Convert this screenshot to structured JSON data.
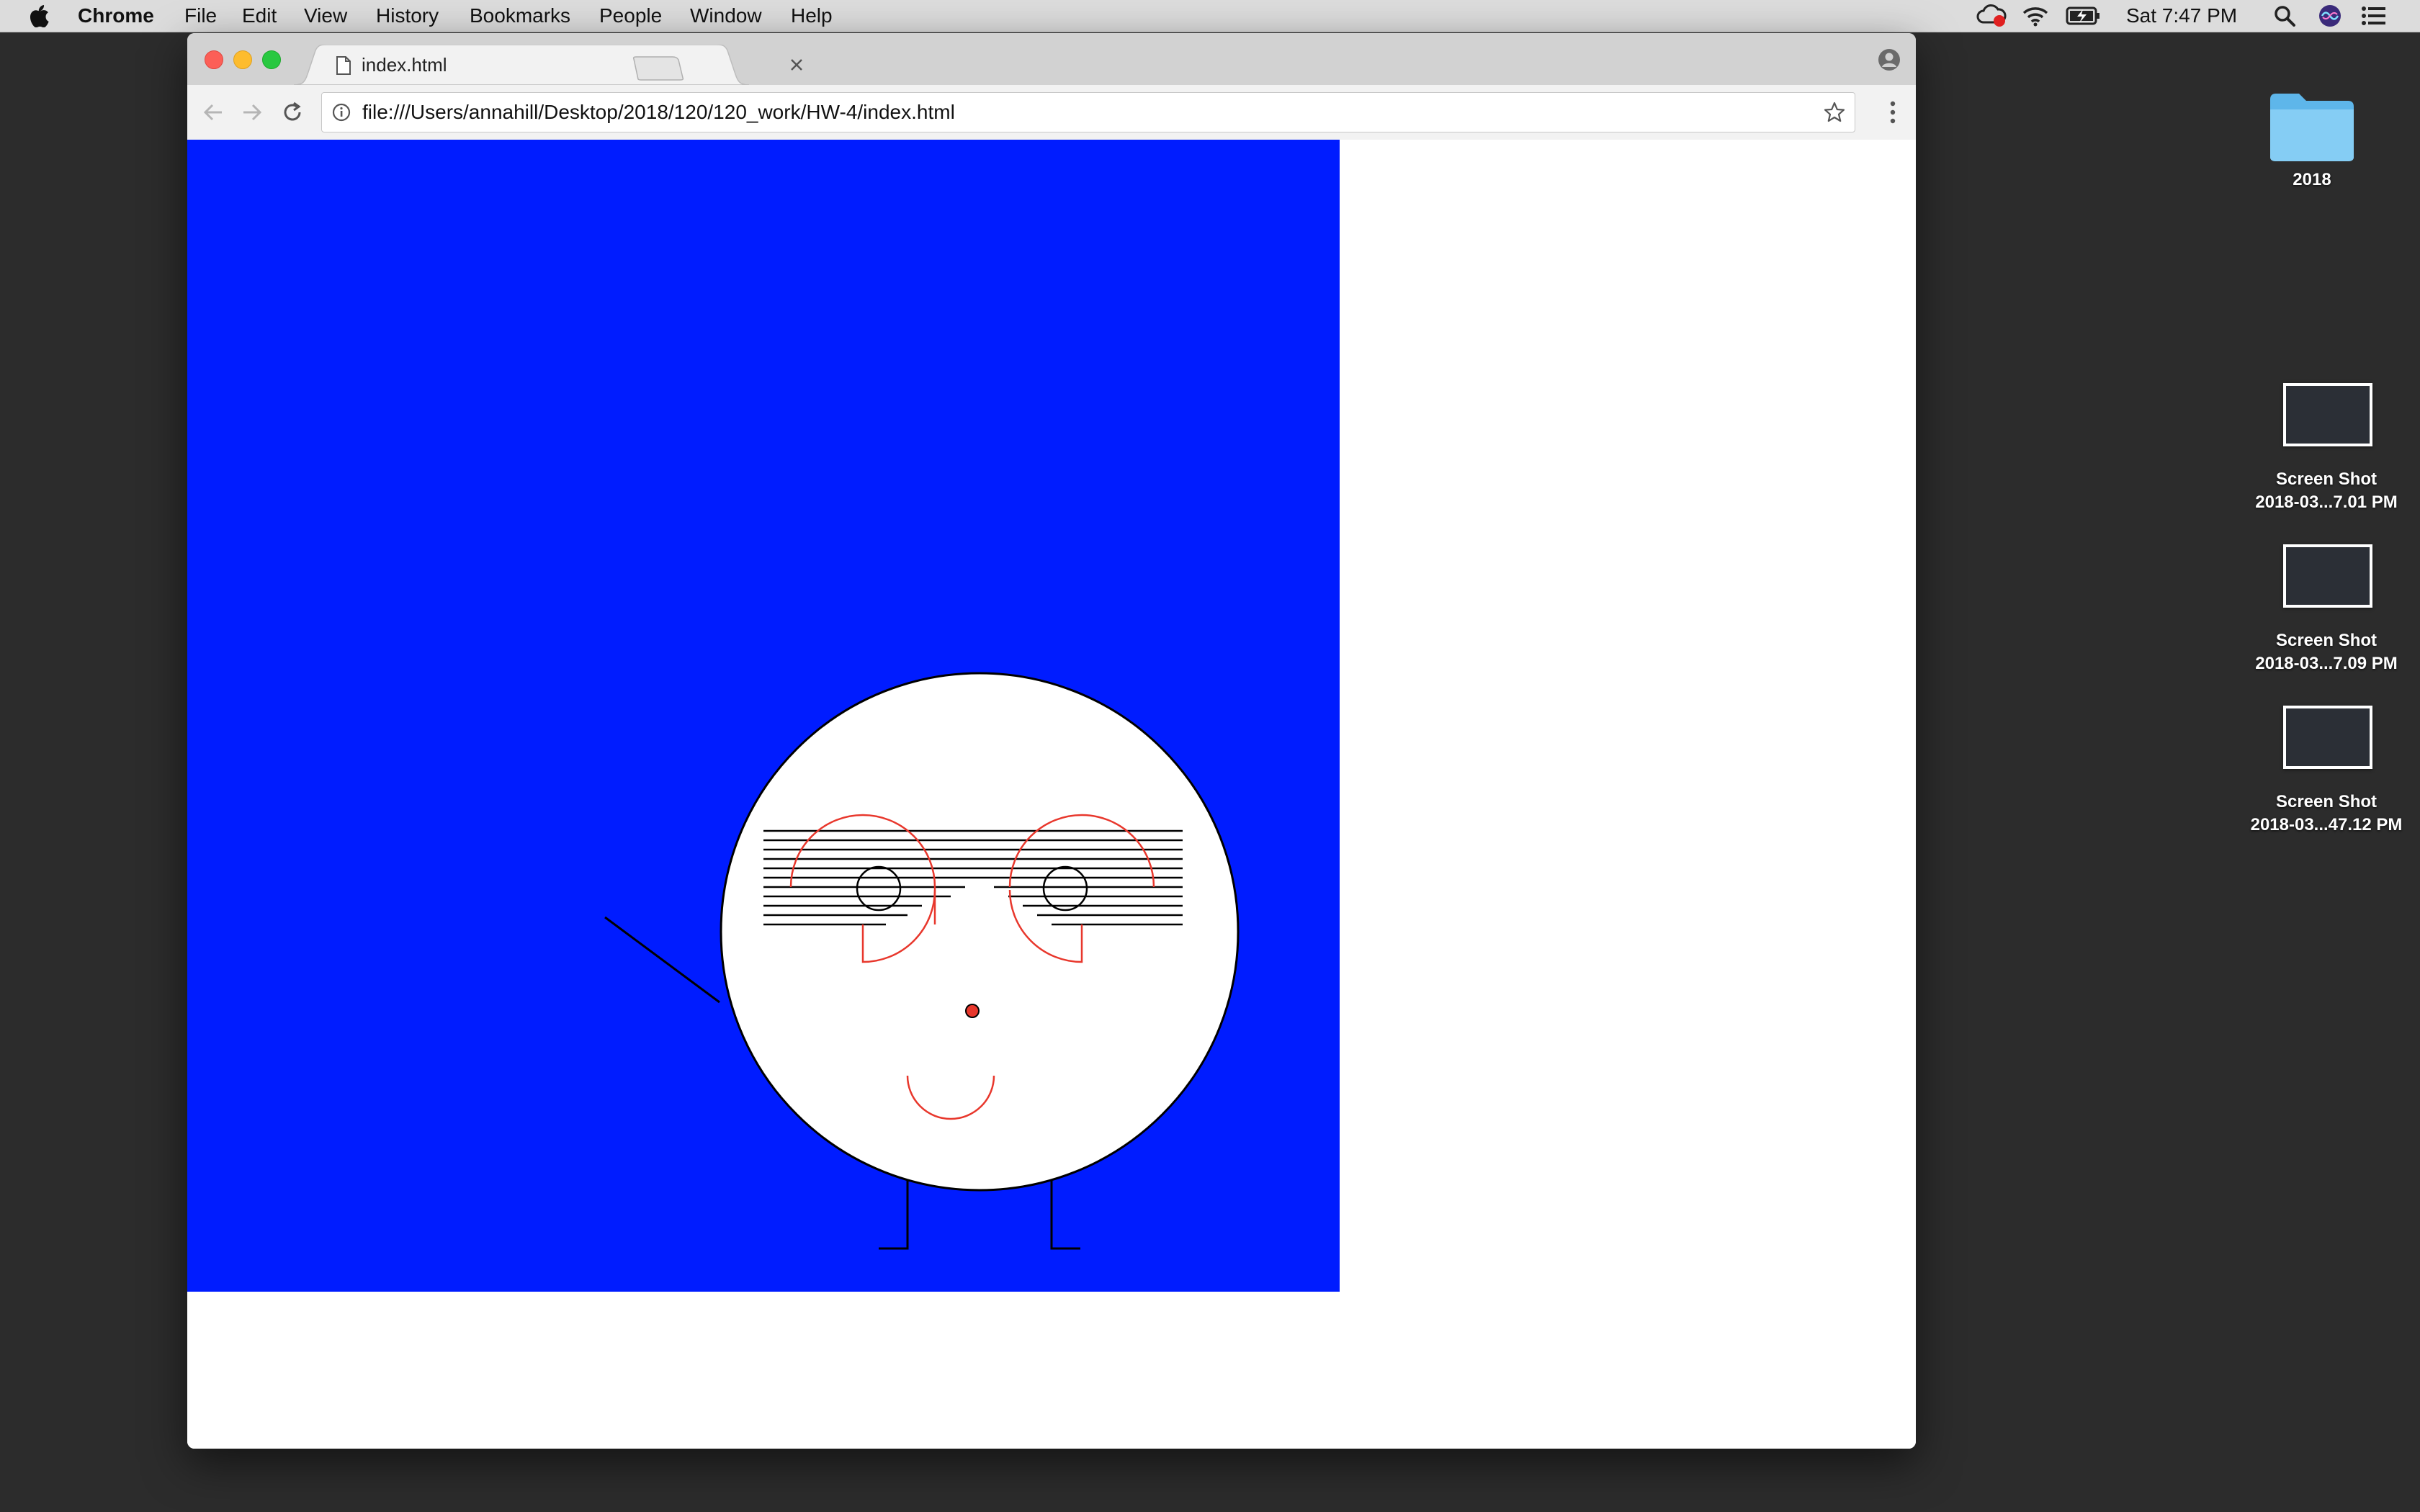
{
  "menubar": {
    "app_name": "Chrome",
    "items": [
      "File",
      "Edit",
      "View",
      "History",
      "Bookmarks",
      "People",
      "Window",
      "Help"
    ],
    "clock": "Sat 7:47 PM"
  },
  "browser": {
    "tab_title": "index.html",
    "url": "file:///Users/annahill/Desktop/2018/120/120_work/HW-4/index.html"
  },
  "sketch": {
    "background_color": "#001cff",
    "face_color": "#ffffff",
    "glasses_color": "#e8372c",
    "nose_color": "#e8372c",
    "line_color": "#000000"
  },
  "desktop": {
    "folder": {
      "label": "2018",
      "color": "#7cc6f0"
    },
    "screenshots": [
      {
        "line1": "Screen Shot",
        "line2": "2018-03...7.01 PM"
      },
      {
        "line1": "Screen Shot",
        "line2": "2018-03...7.09 PM"
      },
      {
        "line1": "Screen Shot",
        "line2": "2018-03...47.12 PM"
      }
    ]
  }
}
